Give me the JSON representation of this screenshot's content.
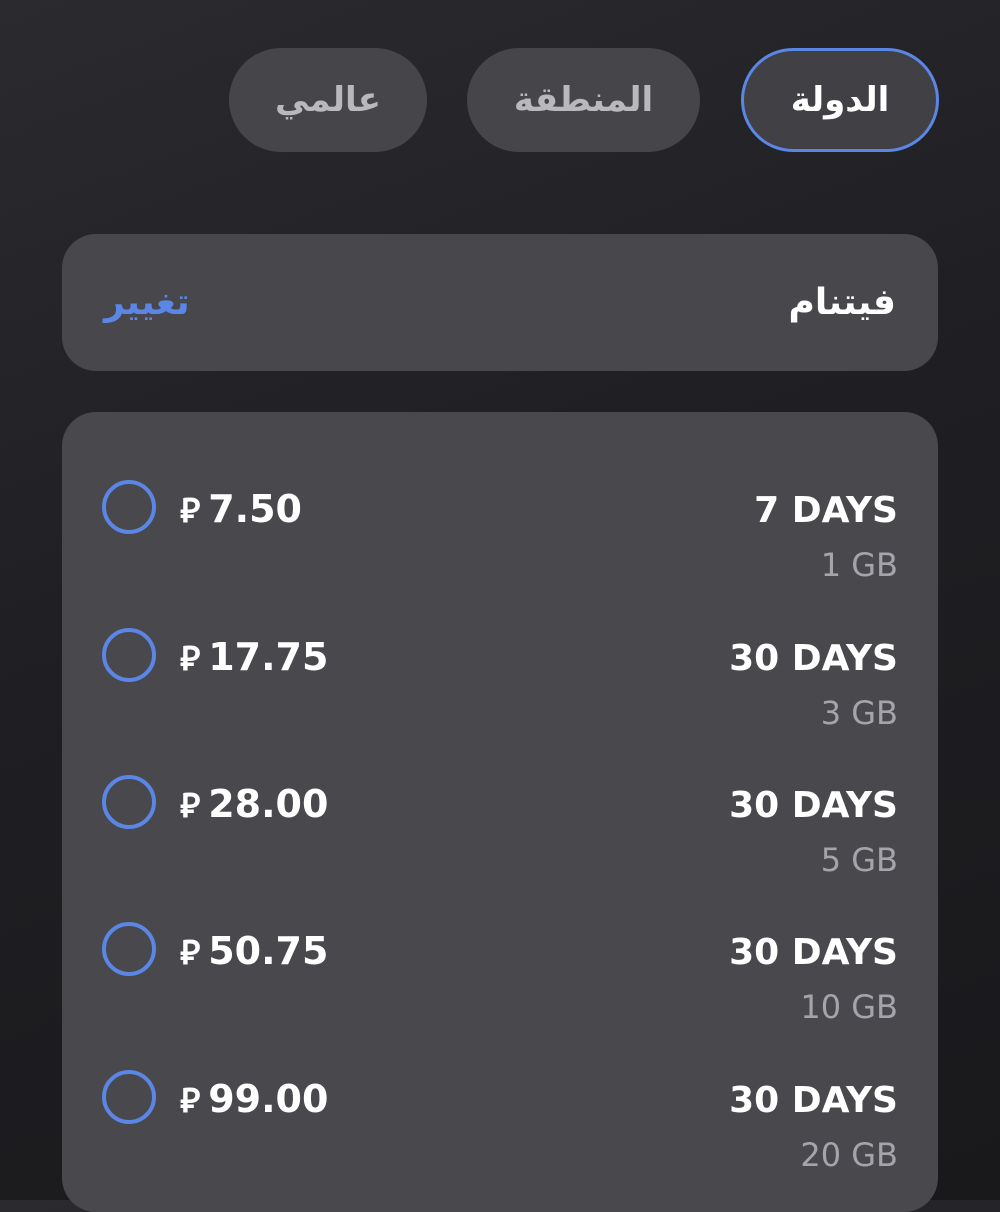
{
  "tabs": {
    "country": "الدولة",
    "region": "المنطقة",
    "global": "عالمي",
    "selected": "country"
  },
  "country_selector": {
    "name": "فيتنام",
    "change_label": "تغيير"
  },
  "currency_symbol": "⃁",
  "plans": [
    {
      "price": "7.50",
      "duration": "7 DAYS",
      "data": "1 GB",
      "selected": false
    },
    {
      "price": "17.75",
      "duration": "30 DAYS",
      "data": "3 GB",
      "selected": false
    },
    {
      "price": "28.00",
      "duration": "30 DAYS",
      "data": "5 GB",
      "selected": false
    },
    {
      "price": "50.75",
      "duration": "30 DAYS",
      "data": "10 GB",
      "selected": false
    },
    {
      "price": "99.00",
      "duration": "30 DAYS",
      "data": "20 GB",
      "selected": false
    }
  ],
  "colors": {
    "accent": "#5b86e5",
    "card": "#48484d",
    "tab": "#45454a",
    "background": "#1f1f23",
    "muted_text": "#a4a4aa"
  },
  "icons": {
    "radio": "radio-unchecked-icon",
    "currency": "riyal-currency-icon"
  }
}
